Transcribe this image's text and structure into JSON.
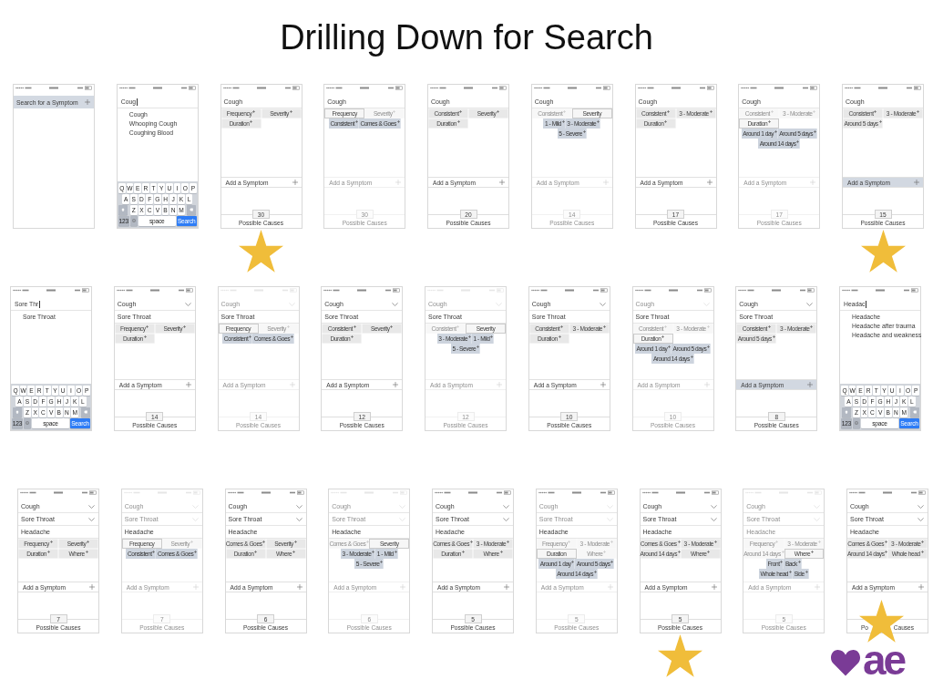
{
  "slide": {
    "title": "Drilling Down for Search"
  },
  "rows": [
    {
      "screens": [
        {
          "kind": "start",
          "search_bar": {
            "label": "Search for a Symptom",
            "highlighted": true
          }
        },
        {
          "kind": "search",
          "query": "Coug",
          "suggestions": [
            "Cough",
            "Whooping Cough",
            "Coughing Blood"
          ],
          "keyboard": {
            "letter_rows": [
              [
                "Q",
                "W",
                "E",
                "R",
                "T",
                "Y",
                "U",
                "I",
                "O",
                "P"
              ],
              [
                "A",
                "S",
                "D",
                "F",
                "G",
                "H",
                "J",
                "K",
                "L"
              ],
              [
                "Z",
                "X",
                "C",
                "V",
                "B",
                "N",
                "M"
              ]
            ],
            "mode_key": "123",
            "space_key": "space",
            "action_key": "Search"
          }
        },
        {
          "kind": "details",
          "status_faded": false,
          "symptoms": [
            {
              "label": "Cough",
              "dropdown": false,
              "faded": false
            }
          ],
          "options": [
            {
              "label": "Frequency",
              "active": false,
              "faded": false,
              "plus": true
            },
            {
              "label": "Severity",
              "active": false,
              "faded": false,
              "plus": true
            },
            {
              "label": "Duration",
              "active": false,
              "faded": false,
              "plus": true
            }
          ],
          "add_symptom": {
            "label": "Add a Symptom",
            "highlighted": false,
            "faded": false
          },
          "counter": {
            "count": "30",
            "label": "Possible Causes",
            "faded": false
          },
          "starred": true,
          "star_over_counter": false
        },
        {
          "kind": "details",
          "status_faded": false,
          "symptoms": [
            {
              "label": "Cough",
              "dropdown": false,
              "faded": false
            }
          ],
          "options": [
            {
              "label": "Frequency",
              "active": true,
              "faded": false,
              "plus": false
            },
            {
              "label": "Severity",
              "active": false,
              "faded": true,
              "plus": true
            }
          ],
          "popup": [
            [
              "Consistent",
              "Comes & Goes"
            ]
          ],
          "add_symptom": {
            "label": "Add a Symptom",
            "highlighted": false,
            "faded": true
          },
          "counter": {
            "count": "30",
            "label": "Possible Causes",
            "faded": true
          }
        },
        {
          "kind": "details",
          "status_faded": false,
          "symptoms": [
            {
              "label": "Cough",
              "dropdown": false,
              "faded": false
            }
          ],
          "options": [
            {
              "label": "Consistent",
              "active": false,
              "faded": false,
              "plus": true
            },
            {
              "label": "Severity",
              "active": false,
              "faded": false,
              "plus": true
            },
            {
              "label": "Duration",
              "active": false,
              "faded": false,
              "plus": true
            }
          ],
          "add_symptom": {
            "label": "Add a Symptom",
            "highlighted": false,
            "faded": false
          },
          "counter": {
            "count": "20",
            "label": "Possible Causes",
            "faded": false
          }
        },
        {
          "kind": "details",
          "status_faded": false,
          "symptoms": [
            {
              "label": "Cough",
              "dropdown": false,
              "faded": false
            }
          ],
          "options": [
            {
              "label": "Consistent",
              "active": false,
              "faded": true,
              "plus": true
            },
            {
              "label": "Severity",
              "active": true,
              "faded": false,
              "plus": false
            }
          ],
          "popup": [
            [
              "1 - Mild",
              "3 - Moderate"
            ],
            [
              "5 - Severe"
            ]
          ],
          "add_symptom": {
            "label": "Add a Symptom",
            "highlighted": false,
            "faded": true
          },
          "counter": {
            "count": "14",
            "label": "Possible Causes",
            "faded": true
          }
        },
        {
          "kind": "details",
          "status_faded": false,
          "symptoms": [
            {
              "label": "Cough",
              "dropdown": false,
              "faded": false
            }
          ],
          "options": [
            {
              "label": "Consistent",
              "active": false,
              "faded": false,
              "plus": true
            },
            {
              "label": "3 - Moderate",
              "active": false,
              "faded": false,
              "plus": true
            },
            {
              "label": "Duration",
              "active": false,
              "faded": false,
              "plus": true
            }
          ],
          "add_symptom": {
            "label": "Add a Symptom",
            "highlighted": false,
            "faded": false
          },
          "counter": {
            "count": "17",
            "label": "Possible Causes",
            "faded": false
          }
        },
        {
          "kind": "details",
          "status_faded": false,
          "symptoms": [
            {
              "label": "Cough",
              "dropdown": false,
              "faded": false
            }
          ],
          "options": [
            {
              "label": "Consistent",
              "active": false,
              "faded": true,
              "plus": true
            },
            {
              "label": "3 - Moderate",
              "active": false,
              "faded": true,
              "plus": true
            },
            {
              "label": "Duration",
              "active": true,
              "faded": false,
              "plus": true
            }
          ],
          "popup": [
            [
              "Around 1 day",
              "Around 5 days"
            ],
            [
              "Around 14 days"
            ]
          ],
          "add_symptom": {
            "label": "Add a Symptom",
            "highlighted": false,
            "faded": true
          },
          "counter": {
            "count": "17",
            "label": "Possible Causes",
            "faded": true
          }
        },
        {
          "kind": "details",
          "status_faded": false,
          "symptoms": [
            {
              "label": "Cough",
              "dropdown": false,
              "faded": false
            }
          ],
          "options": [
            {
              "label": "Consistent",
              "active": false,
              "faded": false,
              "plus": true
            },
            {
              "label": "3 - Moderate",
              "active": false,
              "faded": false,
              "plus": true
            },
            {
              "label": "Around 5 days",
              "active": false,
              "faded": false,
              "plus": true
            }
          ],
          "add_symptom": {
            "label": "Add a Symptom",
            "highlighted": true,
            "faded": false
          },
          "counter": {
            "count": "15",
            "label": "Possible Causes",
            "faded": false
          },
          "starred": true,
          "star_over_counter": false
        }
      ]
    },
    {
      "screens": [
        {
          "kind": "search",
          "query": "Sore Thr",
          "suggestions": [
            "Sore Throat"
          ],
          "keyboard": {
            "letter_rows": [
              [
                "Q",
                "W",
                "E",
                "R",
                "T",
                "Y",
                "U",
                "I",
                "O",
                "P"
              ],
              [
                "A",
                "S",
                "D",
                "F",
                "G",
                "H",
                "J",
                "K",
                "L"
              ],
              [
                "Z",
                "X",
                "C",
                "V",
                "B",
                "N",
                "M"
              ]
            ],
            "mode_key": "123",
            "space_key": "space",
            "action_key": "Search"
          }
        },
        {
          "kind": "details",
          "status_faded": false,
          "symptoms": [
            {
              "label": "Cough",
              "dropdown": true,
              "faded": false
            },
            {
              "label": "Sore Throat",
              "dropdown": false,
              "faded": false
            }
          ],
          "options": [
            {
              "label": "Frequency",
              "active": false,
              "faded": false,
              "plus": true
            },
            {
              "label": "Severity",
              "active": false,
              "faded": false,
              "plus": true
            },
            {
              "label": "Duration",
              "active": false,
              "faded": false,
              "plus": true
            }
          ],
          "add_symptom": {
            "label": "Add a Symptom",
            "highlighted": false,
            "faded": false
          },
          "counter": {
            "count": "14",
            "label": "Possible Causes",
            "faded": false
          }
        },
        {
          "kind": "details",
          "status_faded": true,
          "symptoms": [
            {
              "label": "Cough",
              "dropdown": true,
              "faded": true
            },
            {
              "label": "Sore Throat",
              "dropdown": false,
              "faded": false
            }
          ],
          "options": [
            {
              "label": "Frequency",
              "active": true,
              "faded": false,
              "plus": false
            },
            {
              "label": "Severity",
              "active": false,
              "faded": true,
              "plus": true
            }
          ],
          "popup": [
            [
              "Consistent",
              "Comes & Goes"
            ]
          ],
          "add_symptom": {
            "label": "Add a Symptom",
            "highlighted": false,
            "faded": true
          },
          "counter": {
            "count": "14",
            "label": "Possible Causes",
            "faded": true
          }
        },
        {
          "kind": "details",
          "status_faded": false,
          "symptoms": [
            {
              "label": "Cough",
              "dropdown": true,
              "faded": false
            },
            {
              "label": "Sore Throat",
              "dropdown": false,
              "faded": false
            }
          ],
          "options": [
            {
              "label": "Consistent",
              "active": false,
              "faded": false,
              "plus": true
            },
            {
              "label": "Severity",
              "active": false,
              "faded": false,
              "plus": true
            },
            {
              "label": "Duration",
              "active": false,
              "faded": false,
              "plus": true
            }
          ],
          "add_symptom": {
            "label": "Add a Symptom",
            "highlighted": false,
            "faded": false
          },
          "counter": {
            "count": "12",
            "label": "Possible Causes",
            "faded": false
          }
        },
        {
          "kind": "details",
          "status_faded": true,
          "symptoms": [
            {
              "label": "Cough",
              "dropdown": true,
              "faded": true
            },
            {
              "label": "Sore Throat",
              "dropdown": false,
              "faded": false
            }
          ],
          "options": [
            {
              "label": "Consistent",
              "active": false,
              "faded": true,
              "plus": true
            },
            {
              "label": "Severity",
              "active": true,
              "faded": false,
              "plus": false
            }
          ],
          "popup": [
            [
              "3 - Moderate",
              "1 - Mild"
            ],
            [
              "5 - Severe"
            ]
          ],
          "add_symptom": {
            "label": "Add a Symptom",
            "highlighted": false,
            "faded": true
          },
          "counter": {
            "count": "12",
            "label": "Possible Causes",
            "faded": true
          }
        },
        {
          "kind": "details",
          "status_faded": false,
          "symptoms": [
            {
              "label": "Cough",
              "dropdown": true,
              "faded": false
            },
            {
              "label": "Sore Throat",
              "dropdown": false,
              "faded": false
            }
          ],
          "options": [
            {
              "label": "Consistent",
              "active": false,
              "faded": false,
              "plus": true
            },
            {
              "label": "3 - Moderate",
              "active": false,
              "faded": false,
              "plus": true
            },
            {
              "label": "Duration",
              "active": false,
              "faded": false,
              "plus": true
            }
          ],
          "add_symptom": {
            "label": "Add a Symptom",
            "highlighted": false,
            "faded": false
          },
          "counter": {
            "count": "10",
            "label": "Possible Causes",
            "faded": false
          }
        },
        {
          "kind": "details",
          "status_faded": false,
          "symptoms": [
            {
              "label": "Cough",
              "dropdown": true,
              "faded": true
            },
            {
              "label": "Sore Throat",
              "dropdown": false,
              "faded": false
            }
          ],
          "options": [
            {
              "label": "Consistent",
              "active": false,
              "faded": true,
              "plus": true
            },
            {
              "label": "3 - Moderate",
              "active": false,
              "faded": true,
              "plus": true
            },
            {
              "label": "Duration",
              "active": true,
              "faded": false,
              "plus": true
            }
          ],
          "popup": [
            [
              "Around 1 day",
              "Around 5 days"
            ],
            [
              "Around 14 days"
            ]
          ],
          "add_symptom": {
            "label": "Add a Symptom",
            "highlighted": false,
            "faded": true
          },
          "counter": {
            "count": "10",
            "label": "Possible Causes",
            "faded": true
          }
        },
        {
          "kind": "details",
          "status_faded": false,
          "symptoms": [
            {
              "label": "Cough",
              "dropdown": true,
              "faded": false
            },
            {
              "label": "Sore Throat",
              "dropdown": false,
              "faded": false
            }
          ],
          "options": [
            {
              "label": "Consistent",
              "active": false,
              "faded": false,
              "plus": true
            },
            {
              "label": "3 - Moderate",
              "active": false,
              "faded": false,
              "plus": true
            },
            {
              "label": "Around 5 days",
              "active": false,
              "faded": false,
              "plus": true
            }
          ],
          "add_symptom": {
            "label": "Add a Symptom",
            "highlighted": true,
            "faded": false
          },
          "counter": {
            "count": "8",
            "label": "Possible Causes",
            "faded": false
          }
        },
        {
          "kind": "search",
          "query": "Headac",
          "suggestions": [
            "Headache",
            "Headache after trauma",
            "Headache and weakness"
          ],
          "keyboard": {
            "letter_rows": [
              [
                "Q",
                "W",
                "E",
                "R",
                "T",
                "Y",
                "U",
                "I",
                "O",
                "P"
              ],
              [
                "A",
                "S",
                "D",
                "F",
                "G",
                "H",
                "J",
                "K",
                "L"
              ],
              [
                "Z",
                "X",
                "C",
                "V",
                "B",
                "N",
                "M"
              ]
            ],
            "mode_key": "123",
            "space_key": "space",
            "action_key": "Search"
          }
        }
      ]
    },
    {
      "screens": [
        {
          "kind": "details",
          "status_faded": false,
          "symptoms": [
            {
              "label": "Cough",
              "dropdown": true,
              "faded": false
            },
            {
              "label": "Sore Throat",
              "dropdown": true,
              "faded": false
            },
            {
              "label": "Headache",
              "dropdown": false,
              "faded": false
            }
          ],
          "options": [
            {
              "label": "Frequency",
              "active": false,
              "faded": false,
              "plus": true
            },
            {
              "label": "Severity",
              "active": false,
              "faded": false,
              "plus": true
            },
            {
              "label": "Duration",
              "active": false,
              "faded": false,
              "plus": true
            },
            {
              "label": "Where",
              "active": false,
              "faded": false,
              "plus": true
            }
          ],
          "add_symptom": {
            "label": "Add a Symptom",
            "highlighted": false,
            "faded": false
          },
          "counter": {
            "count": "7",
            "label": "Possible Causes",
            "faded": false
          }
        },
        {
          "kind": "details",
          "status_faded": true,
          "symptoms": [
            {
              "label": "Cough",
              "dropdown": true,
              "faded": true
            },
            {
              "label": "Sore Throat",
              "dropdown": true,
              "faded": true
            },
            {
              "label": "Headache",
              "dropdown": false,
              "faded": false
            }
          ],
          "options": [
            {
              "label": "Frequency",
              "active": true,
              "faded": false,
              "plus": false
            },
            {
              "label": "Severity",
              "active": false,
              "faded": true,
              "plus": true
            }
          ],
          "popup": [
            [
              "Consistent",
              "Comes & Goes"
            ]
          ],
          "add_symptom": {
            "label": "Add a Symptom",
            "highlighted": false,
            "faded": true
          },
          "counter": {
            "count": "7",
            "label": "Possible Causes",
            "faded": true
          }
        },
        {
          "kind": "details",
          "status_faded": false,
          "symptoms": [
            {
              "label": "Cough",
              "dropdown": true,
              "faded": false
            },
            {
              "label": "Sore Throat",
              "dropdown": true,
              "faded": false
            },
            {
              "label": "Headache",
              "dropdown": false,
              "faded": false
            }
          ],
          "options": [
            {
              "label": "Comes & Goes",
              "active": false,
              "faded": false,
              "plus": true
            },
            {
              "label": "Severity",
              "active": false,
              "faded": false,
              "plus": true
            },
            {
              "label": "Duration",
              "active": false,
              "faded": false,
              "plus": true
            },
            {
              "label": "Where",
              "active": false,
              "faded": false,
              "plus": true
            }
          ],
          "add_symptom": {
            "label": "Add a Symptom",
            "highlighted": false,
            "faded": false
          },
          "counter": {
            "count": "6",
            "label": "Possible Causes",
            "faded": false
          }
        },
        {
          "kind": "details",
          "status_faded": true,
          "symptoms": [
            {
              "label": "Cough",
              "dropdown": true,
              "faded": true
            },
            {
              "label": "Sore Throat",
              "dropdown": true,
              "faded": true
            },
            {
              "label": "Headache",
              "dropdown": false,
              "faded": false
            }
          ],
          "options": [
            {
              "label": "Comes & Goes",
              "active": false,
              "faded": true,
              "plus": true
            },
            {
              "label": "Severity",
              "active": true,
              "faded": false,
              "plus": false
            }
          ],
          "popup": [
            [
              "3 - Moderate",
              "1 - Mild"
            ],
            [
              "5 - Severe"
            ]
          ],
          "add_symptom": {
            "label": "Add a Symptom",
            "highlighted": false,
            "faded": true
          },
          "counter": {
            "count": "6",
            "label": "Possible Causes",
            "faded": true
          }
        },
        {
          "kind": "details",
          "status_faded": false,
          "symptoms": [
            {
              "label": "Cough",
              "dropdown": true,
              "faded": false
            },
            {
              "label": "Sore Throat",
              "dropdown": true,
              "faded": false
            },
            {
              "label": "Headache",
              "dropdown": false,
              "faded": false
            }
          ],
          "options": [
            {
              "label": "Comes & Goes",
              "active": false,
              "faded": false,
              "plus": true
            },
            {
              "label": "3 - Moderate",
              "active": false,
              "faded": false,
              "plus": true
            },
            {
              "label": "Duration",
              "active": false,
              "faded": false,
              "plus": true
            },
            {
              "label": "Where",
              "active": false,
              "faded": false,
              "plus": true
            }
          ],
          "add_symptom": {
            "label": "Add a Symptom",
            "highlighted": false,
            "faded": false
          },
          "counter": {
            "count": "5",
            "label": "Possible Causes",
            "faded": false
          }
        },
        {
          "kind": "details",
          "status_faded": false,
          "symptoms": [
            {
              "label": "Cough",
              "dropdown": true,
              "faded": true
            },
            {
              "label": "Sore Throat",
              "dropdown": true,
              "faded": true
            },
            {
              "label": "Headache",
              "dropdown": false,
              "faded": false
            }
          ],
          "options": [
            {
              "label": "Frequency",
              "active": false,
              "faded": true,
              "plus": true
            },
            {
              "label": "3 - Moderate",
              "active": false,
              "faded": true,
              "plus": true
            },
            {
              "label": "Duration",
              "active": true,
              "faded": false,
              "plus": false
            },
            {
              "label": "Where",
              "active": false,
              "faded": true,
              "plus": true
            }
          ],
          "popup": [
            [
              "Around 1 day",
              "Around 5 days"
            ],
            [
              "Around 14 days"
            ]
          ],
          "add_symptom": {
            "label": "Add a Symptom",
            "highlighted": false,
            "faded": true
          },
          "counter": {
            "count": "5",
            "label": "Possible Causes",
            "faded": true
          }
        },
        {
          "kind": "details",
          "status_faded": false,
          "symptoms": [
            {
              "label": "Cough",
              "dropdown": true,
              "faded": false
            },
            {
              "label": "Sore Throat",
              "dropdown": true,
              "faded": false
            },
            {
              "label": "Headache",
              "dropdown": false,
              "faded": false
            }
          ],
          "options": [
            {
              "label": "Comes & Goes",
              "active": false,
              "faded": false,
              "plus": true
            },
            {
              "label": "3 - Moderate",
              "active": false,
              "faded": false,
              "plus": true
            },
            {
              "label": "Around 14 days",
              "active": false,
              "faded": false,
              "plus": true
            },
            {
              "label": "Where",
              "active": false,
              "faded": false,
              "plus": true
            }
          ],
          "add_symptom": {
            "label": "Add a Symptom",
            "highlighted": false,
            "faded": false
          },
          "counter": {
            "count": "5",
            "label": "Possible Causes",
            "faded": false
          },
          "starred": true,
          "star_over_counter": false
        },
        {
          "kind": "details",
          "status_faded": true,
          "symptoms": [
            {
              "label": "Cough",
              "dropdown": true,
              "faded": true
            },
            {
              "label": "Sore Throat",
              "dropdown": true,
              "faded": true
            },
            {
              "label": "Headache",
              "dropdown": false,
              "faded": true
            }
          ],
          "options": [
            {
              "label": "Frequency",
              "active": false,
              "faded": true,
              "plus": true
            },
            {
              "label": "3 - Moderate",
              "active": false,
              "faded": true,
              "plus": true
            },
            {
              "label": "Around 14 days",
              "active": false,
              "faded": true,
              "plus": true
            },
            {
              "label": "Where",
              "active": true,
              "faded": false,
              "plus": true
            }
          ],
          "popup": [
            [
              "Front",
              "Back"
            ],
            [
              "Whole head",
              "Side"
            ]
          ],
          "add_symptom": {
            "label": "Add a Symptom",
            "highlighted": false,
            "faded": true
          },
          "counter": {
            "count": "5",
            "label": "Possible Causes",
            "faded": true
          }
        },
        {
          "kind": "details",
          "status_faded": false,
          "symptoms": [
            {
              "label": "Cough",
              "dropdown": true,
              "faded": false
            },
            {
              "label": "Sore Throat",
              "dropdown": true,
              "faded": false
            },
            {
              "label": "Headache",
              "dropdown": false,
              "faded": false
            }
          ],
          "options": [
            {
              "label": "Comes & Goes",
              "active": false,
              "faded": false,
              "plus": true
            },
            {
              "label": "3 - Moderate",
              "active": false,
              "faded": false,
              "plus": true
            },
            {
              "label": "Around 14 days",
              "active": false,
              "faded": false,
              "plus": true
            },
            {
              "label": "Whole head",
              "active": false,
              "faded": false,
              "plus": true
            }
          ],
          "add_symptom": {
            "label": "Add a Symptom",
            "highlighted": false,
            "faded": false
          },
          "counter": {
            "label_parts": [
              "Po",
              "Causes"
            ],
            "faded": false
          },
          "starred": true,
          "star_over_counter": true
        }
      ]
    }
  ],
  "logo": {
    "text": "ae"
  }
}
